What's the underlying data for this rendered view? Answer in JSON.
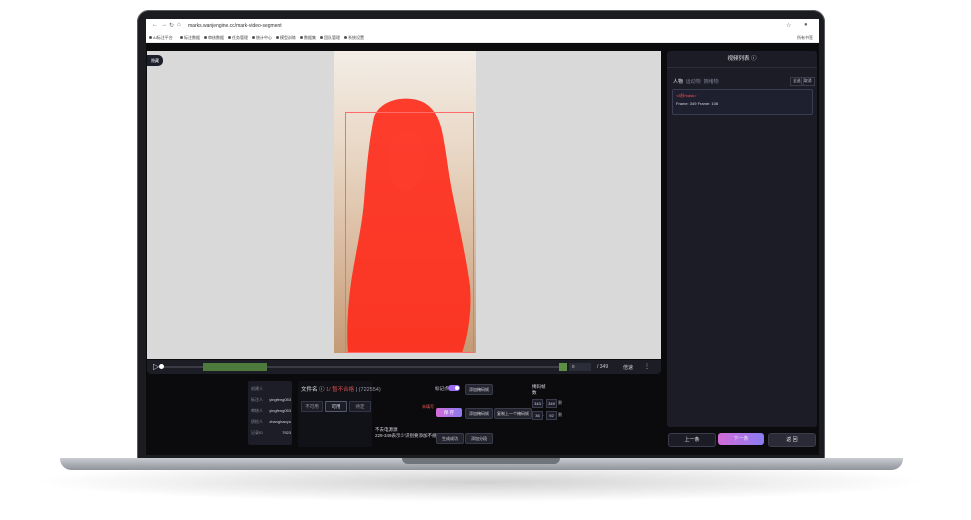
{
  "browser": {
    "url": "marks.wanjengine.cc/mark-video-segment",
    "bookmarks": [
      "AI标注平台",
      "标注数据",
      "审核数据",
      "任务管理",
      "统计中心",
      "模型训练",
      "数据集",
      "团队管理",
      "系统设置"
    ],
    "bookmarks_right": "所有书签"
  },
  "canvas": {
    "download_label": "隐藏",
    "frame_current": "0",
    "frame_total": "/ 349",
    "speed_label": "倍速",
    "more_label": "⋮",
    "progress": 0.0
  },
  "info": {
    "rows": [
      {
        "label": "创建人",
        "value": ""
      },
      {
        "label": "标注人",
        "value": "yingfeng053"
      },
      {
        "label": "审核人",
        "value": "yingfeng053"
      },
      {
        "label": "质检人",
        "value": "zhanghaoyu"
      },
      {
        "label": "记录ID",
        "value": "7923"
      }
    ]
  },
  "file": {
    "title": "文件名 ⓘ",
    "status_red": "1/ 暂不合格 ",
    "status_rest": "| (722554)",
    "buttons": [
      "不可用",
      "可用",
      "待定"
    ]
  },
  "task": {
    "line1": "不去电源源",
    "line2": "229-349表示少识别要添加不规则面"
  },
  "controls": {
    "mark_label": "标记点",
    "add_mask_label": "添加掩码帧",
    "red_label": "未填写",
    "save_label": "保 存",
    "add_mask_label2": "添加掩码帧",
    "copy_label": "复制上一个掩码帧",
    "range_header": "掩码帧\n数",
    "ranges": [
      {
        "from": "343",
        "sep": "-",
        "to": "349",
        "del": "删"
      },
      {
        "from": "36",
        "sep": "-",
        "to": "92",
        "del": "删"
      }
    ],
    "generate_label": "生成成功",
    "add_segment_label": "添加分段"
  },
  "right": {
    "header": "视频列表 ⓘ",
    "tabs": [
      "人物",
      "运动物",
      "拥堵物"
    ],
    "mini_buttons": [
      "全选",
      "取消"
    ],
    "item_title": "<8秒mask>",
    "item_meta": "Frame: 349   Frame: 108",
    "prev_label": "上一条",
    "next_label": "下一条",
    "back_label": "返 回"
  },
  "colors": {
    "accent_purple": "#9b6cf0",
    "mask_red": "#ff2a1a",
    "status_red": "#e14c4c"
  }
}
